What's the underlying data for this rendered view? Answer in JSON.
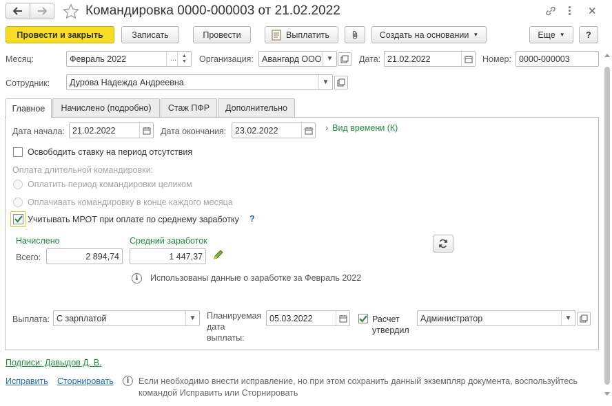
{
  "title": "Командировка 0000-000003 от 21.02.2022",
  "toolbar": {
    "post_close": "Провести и закрыть",
    "save": "Записать",
    "post": "Провести",
    "pay": "Выплатить",
    "create_based": "Создать на основании",
    "more": "Еще",
    "help": "?"
  },
  "header": {
    "month_label": "Месяц:",
    "month_value": "Февраль 2022",
    "org_label": "Организация:",
    "org_value": "Авангард ООО",
    "date_label": "Дата:",
    "date_value": "21.02.2022",
    "number_label": "Номер:",
    "number_value": "0000-000003",
    "employee_label": "Сотрудник:",
    "employee_value": "Дурова Надежда Андреевна"
  },
  "tabs": [
    "Главное",
    "Начислено (подробно)",
    "Стаж ПФР",
    "Дополнительно"
  ],
  "main": {
    "start_label": "Дата начала:",
    "start_value": "21.02.2022",
    "end_label": "Дата окончания:",
    "end_value": "23.02.2022",
    "time_type_link": "Вид времени (К)",
    "release_rate": "Освободить ставку на период отсутствия",
    "long_trip_label": "Оплата длительной командировки:",
    "pay_whole": "Оплатить период командировки целиком",
    "pay_monthly": "Оплачивать командировку в конце каждого месяца",
    "mrot_label": "Учитывать МРОТ при оплате по среднему заработку",
    "mrot_help": "?",
    "accrued_header": "Начислено",
    "avg_header": "Средний заработок",
    "total_label": "Всего:",
    "total_value": "2 894,74",
    "avg_value": "1 447,37",
    "info_text": "Использованы данные о заработке за Февраль 2022",
    "payout_label": "Выплата:",
    "payout_value": "С зарплатой",
    "planned_date_label": "Планируемая дата выплаты:",
    "planned_date_value": "05.03.2022",
    "calc_approved_label": "Расчет утвердил",
    "approver_value": "Администратор"
  },
  "footer": {
    "signatures": "Подписи: Давыдов Д. В.",
    "fix_link": "Исправить",
    "storno_link": "Сторнировать",
    "note": "Если необходимо внести исправление, но при этом сохранить данный экземпляр документа, воспользуйтесь командой Исправить или Сторнировать"
  }
}
